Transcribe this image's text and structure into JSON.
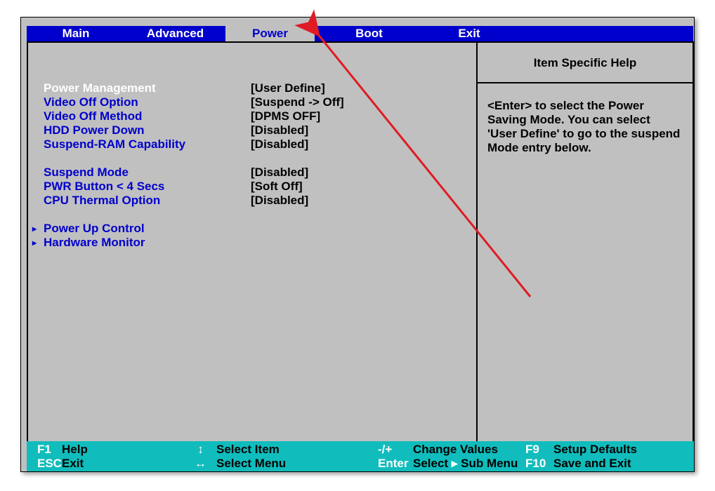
{
  "tabs": {
    "main": "Main",
    "advanced": "Advanced",
    "power": "Power",
    "boot": "Boot",
    "exit": "Exit"
  },
  "settings": [
    {
      "label": "Power Management",
      "value": "[User Define]",
      "selected": true
    },
    {
      "label": "Video Off Option",
      "value": "[Suspend -> Off]",
      "selected": false
    },
    {
      "label": "Video Off Method",
      "value": "[DPMS OFF]",
      "selected": false
    },
    {
      "label": "HDD Power Down",
      "value": "[Disabled]",
      "selected": false
    },
    {
      "label": "Suspend-RAM Capability",
      "value": "[Disabled]",
      "selected": false
    }
  ],
  "settings2": [
    {
      "label": "Suspend Mode",
      "value": "[Disabled]",
      "selected": false
    },
    {
      "label": "PWR Button < 4 Secs",
      "value": "[Soft Off]",
      "selected": false
    },
    {
      "label": "CPU Thermal Option",
      "value": "[Disabled]",
      "selected": false
    }
  ],
  "submenus": [
    {
      "label": "Power Up Control"
    },
    {
      "label": "Hardware Monitor"
    }
  ],
  "help": {
    "title": "Item Specific Help",
    "body": "<Enter> to select the Power Saving Mode. You can select 'User Define' to go to the suspend Mode entry below."
  },
  "legend": {
    "r1": {
      "k1": "F1",
      "v1": "Help",
      "k2": "↕",
      "v2": "Select Item",
      "k3": "-/+",
      "v3": "Change Values",
      "k4": "F9",
      "v4": "Setup Defaults"
    },
    "r2": {
      "k1": "ESC",
      "v1": "Exit",
      "k2": "↔",
      "v2": "Select Menu",
      "k3": "Enter",
      "v3a": "Select",
      "arrow": "▸",
      "v3b": "Sub Menu",
      "k4": "F10",
      "v4": "Save and Exit"
    }
  }
}
